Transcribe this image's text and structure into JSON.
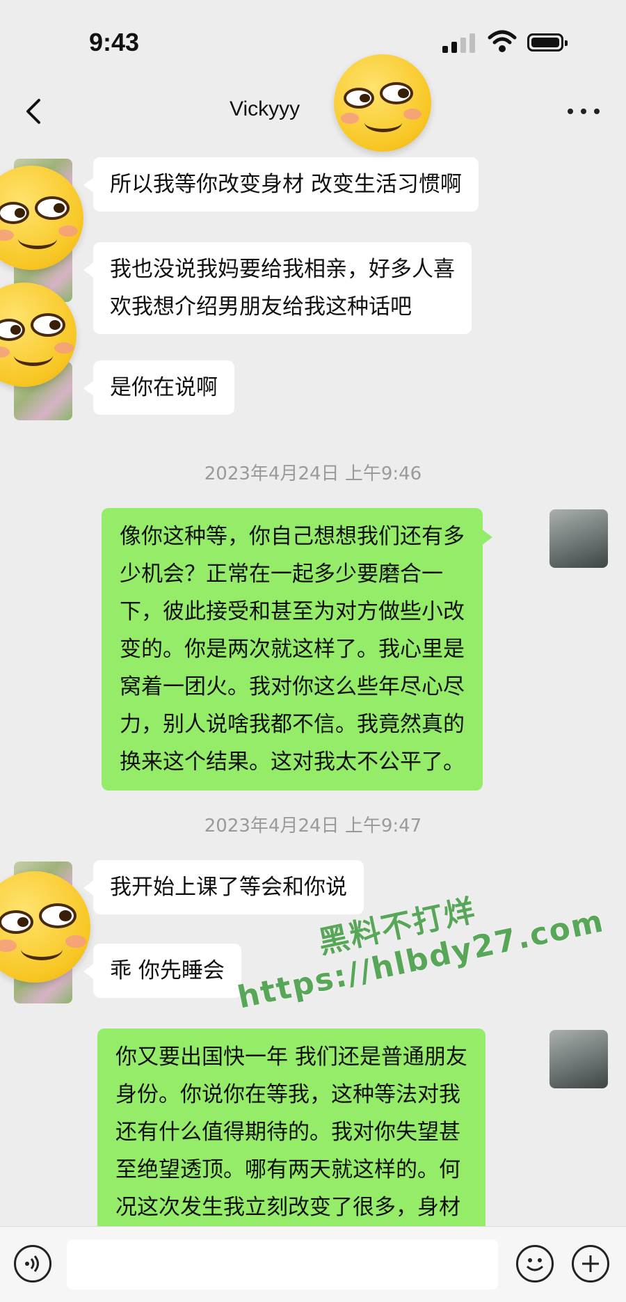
{
  "status_bar": {
    "time": "9:43"
  },
  "header": {
    "title": "Vickyyy"
  },
  "messages": [
    {
      "side": "left",
      "text": "所以我等你改变身材 改变生活习惯啊"
    },
    {
      "side": "left",
      "text": "我也没说我妈要给我相亲，好多人喜\n欢我想介绍男朋友给我这种话吧"
    },
    {
      "side": "left",
      "text": "是你在说啊"
    },
    {
      "side": "right",
      "text": "像你这种等，你自己想想我们还有多\n少机会？正常在一起多少要磨合一\n下，彼此接受和甚至为对方做些小改\n变的。你是两次就这样了。我心里是\n窝着一团火。我对你这么些年尽心尽\n力，别人说啥我都不信。我竟然真的\n换来这个结果。这对我太不公平了。"
    },
    {
      "side": "left",
      "text": "我开始上课了等会和你说"
    },
    {
      "side": "left",
      "text": "乖 你先睡会"
    },
    {
      "side": "right",
      "text": "你又要出国快一年 我们还是普通朋友\n身份。你说你在等我，这种等法对我\n还有什么值得期待的。我对你失望甚\n至绝望透顶。哪有两天就这样的。何\n况这次发生我立刻改变了很多，身材\n也瘦了不少，而你对我还是无动于"
    }
  ],
  "timestamps": [
    "2023年4月24日 上午9:46",
    "2023年4月24日 上午9:47"
  ],
  "watermark": {
    "line1": "黑料不打烊",
    "line2": "https://hlbdy27.com"
  },
  "input_bar": {
    "placeholder": ""
  },
  "colors": {
    "background": "#ededed",
    "my_bubble": "#95ec69",
    "their_bubble": "#ffffff"
  }
}
